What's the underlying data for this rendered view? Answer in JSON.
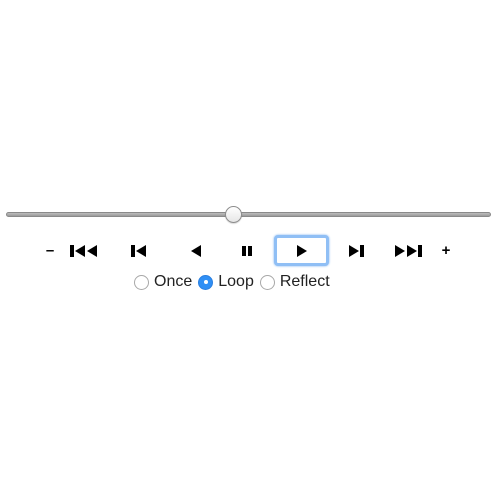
{
  "slider": {
    "value": 0.47,
    "min": 0,
    "max": 1
  },
  "controls": {
    "decrease_label": "–",
    "increase_label": "+",
    "buttons": [
      {
        "name": "first-frame",
        "icon": "skip-to-first-icon"
      },
      {
        "name": "previous-frame",
        "icon": "step-back-icon"
      },
      {
        "name": "play-reverse",
        "icon": "play-reverse-icon"
      },
      {
        "name": "pause",
        "icon": "pause-icon"
      },
      {
        "name": "play",
        "icon": "play-icon",
        "focused": true
      },
      {
        "name": "next-frame",
        "icon": "step-forward-icon"
      },
      {
        "name": "last-frame",
        "icon": "skip-to-last-icon"
      }
    ]
  },
  "modes": {
    "options": [
      {
        "label": "Once",
        "checked": false
      },
      {
        "label": "Loop",
        "checked": true
      },
      {
        "label": "Reflect",
        "checked": false
      }
    ],
    "accent": "#2f8ff5"
  }
}
